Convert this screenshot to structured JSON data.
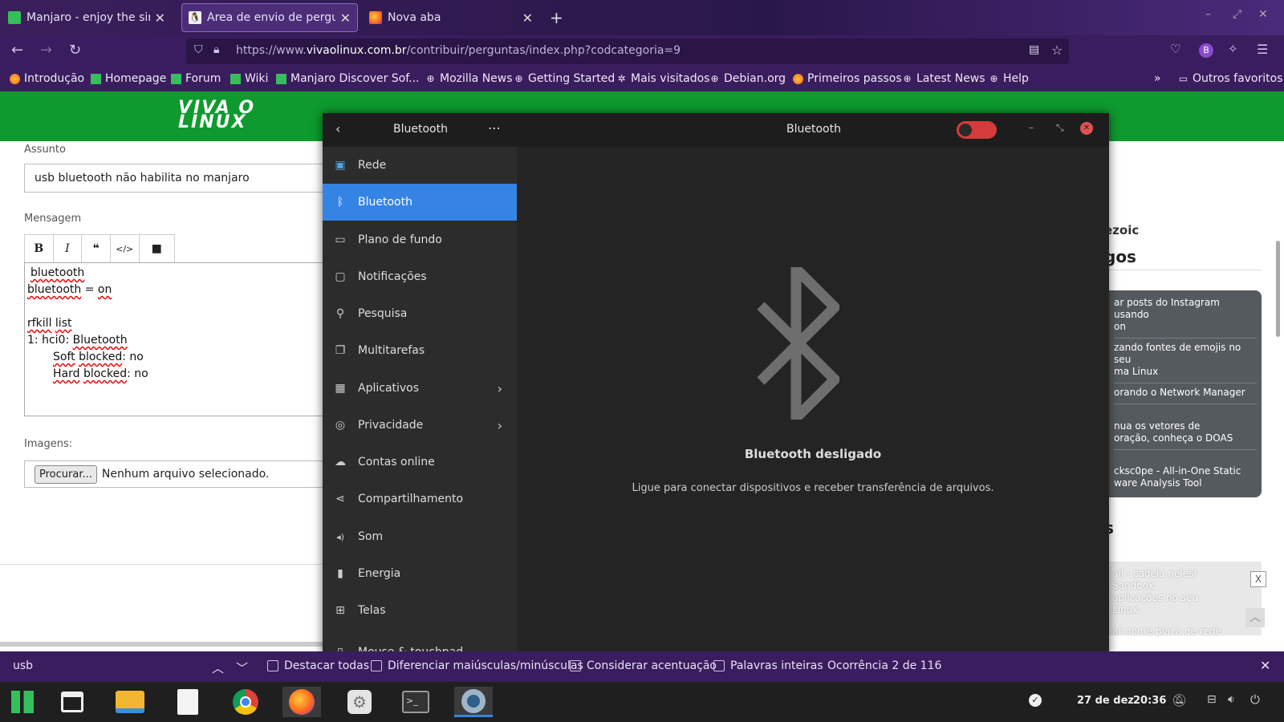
{
  "browser": {
    "tabs": [
      {
        "label": "Manjaro - enjoy the simplici",
        "active": false
      },
      {
        "label": "Área de envio de pergunta",
        "active": true
      },
      {
        "label": "Nova aba",
        "active": false
      }
    ],
    "url": {
      "prefix": "https://www.",
      "domain": "vivaolinux.com.br",
      "path": "/contribuir/perguntas/index.php?codcategoria=9"
    },
    "profile_initial": "B",
    "bookmarks": [
      "Introdução",
      "Homepage",
      "Forum",
      "Wiki",
      "Manjaro Discover Sof...",
      "Mozilla News",
      "Getting Started",
      "Mais visitados",
      "Debian.org",
      "Primeiros passos",
      "Latest News",
      "Help"
    ],
    "other_bookmarks": "Outros favoritos",
    "colors": {
      "chrome": "#3a1d5e",
      "site_green": "#0e9a2e",
      "accent": "#3584e4"
    }
  },
  "site": {
    "logo": [
      "VIVA O",
      "LINUX"
    ],
    "form": {
      "assunto_label": "Assunto",
      "assunto_value": "usb bluetooth não habilita no manjaro",
      "mensagem_label": "Mensagem",
      "toolbar": {
        "bold": "B",
        "italic": "I",
        "quote": "❝",
        "code": "</>",
        "video": "■"
      },
      "message_lines": {
        "l1": "bluetooth",
        "l2a": "bluetooth",
        "l2b": " = ",
        "l2c": "on",
        "l3a": "rfkill",
        "l3b": " ",
        "l3c": "list",
        "l4a": "1: hci0: ",
        "l4b": "Bluetooth",
        "l5a": "Soft",
        "l5b": " ",
        "l5c": "blocked",
        "l5d": ": no",
        "l6a": "Hard",
        "l6b": " ",
        "l6c": "blocked",
        "l6d": ": no"
      },
      "imagens_label": "Imagens:",
      "file_button": "Procurar...",
      "file_status": "Nenhum arquivo selecionado."
    },
    "side": {
      "ezoic": "ezoic",
      "section1": "gos",
      "items": [
        "ar posts do Instagram usando\non",
        "zando fontes de emojis no seu\nma Linux",
        "orando o Network Manager",
        "nua os vetores de\noração, conheça o DOAS",
        "cksc0pe - All-in-One Static\nware Analysis Tool"
      ],
      "section2": "s",
      "ad_text": "ail - cadeia neles! Sandbox\naplicações no seu\nLinux",
      "ad_close": "X",
      "ad_bottom": "ar nome placa de rede"
    }
  },
  "settings": {
    "sidebar_title": "Bluetooth",
    "window_title": "Bluetooth",
    "menu_dots": "⋯",
    "toggle_on": false,
    "items": [
      {
        "label": "Rede",
        "icon": "network-icon",
        "glyph": "▣"
      },
      {
        "label": "Bluetooth",
        "icon": "bluetooth-icon",
        "glyph": "ᛒ"
      },
      {
        "label": "Plano de fundo",
        "icon": "background-icon",
        "glyph": "▭"
      },
      {
        "label": "Notificações",
        "icon": "notifications-icon",
        "glyph": "▢"
      },
      {
        "label": "Pesquisa",
        "icon": "search-icon",
        "glyph": "⚲"
      },
      {
        "label": "Multitarefas",
        "icon": "multitask-icon",
        "glyph": "❐"
      },
      {
        "label": "Aplicativos",
        "icon": "apps-icon",
        "glyph": "▦",
        "chevron": true
      },
      {
        "label": "Privacidade",
        "icon": "privacy-icon",
        "glyph": "◎",
        "chevron": true
      },
      {
        "label": "Contas online",
        "icon": "cloud-icon",
        "glyph": "☁"
      },
      {
        "label": "Compartilhamento",
        "icon": "share-icon",
        "glyph": "⋖"
      },
      {
        "label": "Som",
        "icon": "sound-icon",
        "glyph": "◂)"
      },
      {
        "label": "Energia",
        "icon": "power-icon",
        "glyph": "▮"
      },
      {
        "label": "Telas",
        "icon": "displays-icon",
        "glyph": "⊞"
      },
      {
        "label": "Mouse & touchpad",
        "icon": "mouse-icon",
        "glyph": "▯"
      }
    ],
    "selected": "Bluetooth",
    "status_title": "Bluetooth desligado",
    "status_desc": "Ligue para conectar dispositivos e receber transferência de arquivos."
  },
  "findbar": {
    "query": "usb",
    "options": [
      "Destacar todas",
      "Diferenciar maiúsculas/minúsculas",
      "Considerar acentuação",
      "Palavras inteiras"
    ],
    "occurrence": "Ocorrência 2 de 116"
  },
  "taskbar": {
    "apps": [
      "manjaro-icon",
      "calendar-icon",
      "files-icon",
      "text-editor-icon",
      "chrome-icon",
      "firefox-icon",
      "settings-icon",
      "terminal-icon",
      "gnome-settings-icon"
    ],
    "date": "27 de dez",
    "time": "20:36"
  }
}
